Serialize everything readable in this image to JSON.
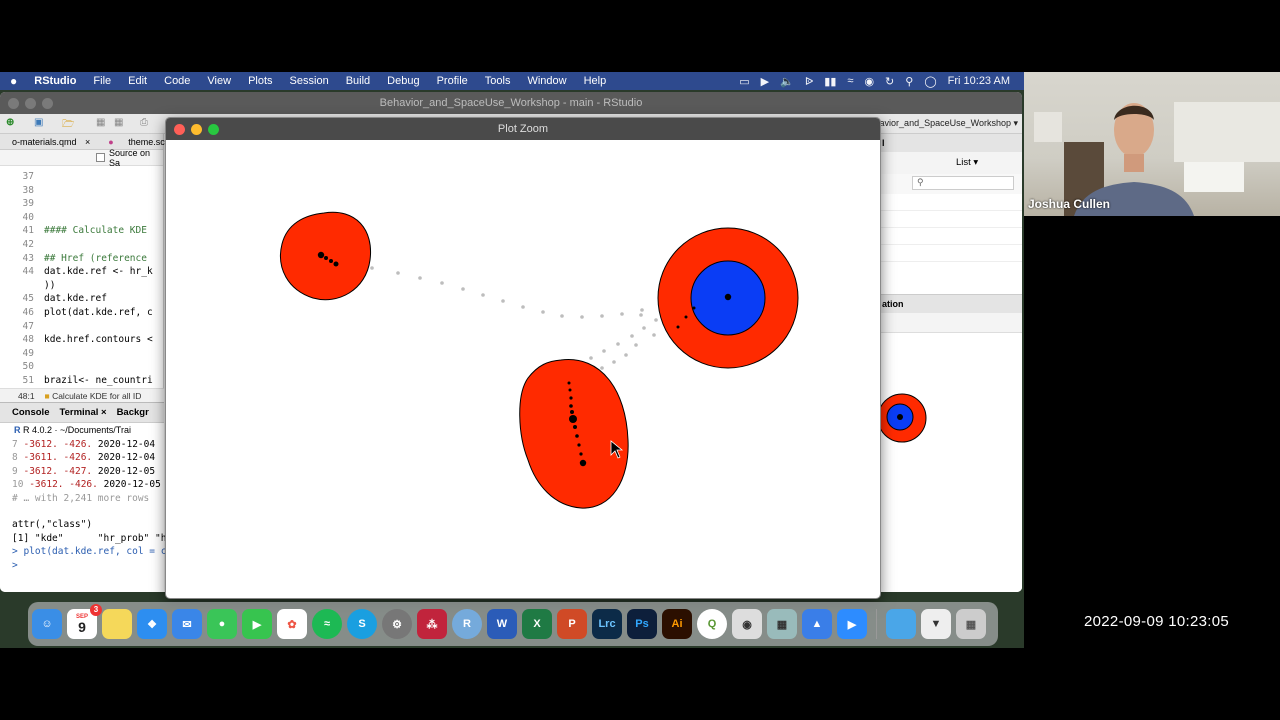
{
  "menubar": {
    "apple": "",
    "items": [
      "RStudio",
      "File",
      "Edit",
      "Code",
      "View",
      "Plots",
      "Session",
      "Build",
      "Debug",
      "Profile",
      "Tools",
      "Window",
      "Help"
    ],
    "clock": "Fri 10:23 AM"
  },
  "rstudio": {
    "window_title": "Behavior_and_SpaceUse_Workshop - main - RStudio",
    "project_label": "avior_and_SpaceUse_Workshop",
    "tabs": [
      "o-materials.qmd",
      "theme.scss"
    ],
    "source_on_save": "Source on Sa",
    "code_lines": [
      {
        "n": "37",
        "t": ""
      },
      {
        "n": "38",
        "t": ""
      },
      {
        "n": "39",
        "t": ""
      },
      {
        "n": "40",
        "t": ""
      },
      {
        "n": "41",
        "t": "#### Calculate KDE"
      },
      {
        "n": "42",
        "t": ""
      },
      {
        "n": "43",
        "t": "## Href (reference"
      },
      {
        "n": "44",
        "t": "dat.kde.ref <- hr_k"
      },
      {
        "n": "",
        "t": "))"
      },
      {
        "n": "45",
        "t": "dat.kde.ref"
      },
      {
        "n": "46",
        "t": "plot(dat.kde.ref, c"
      },
      {
        "n": "47",
        "t": ""
      },
      {
        "n": "48",
        "t": "kde.href.contours <"
      },
      {
        "n": "49",
        "t": ""
      },
      {
        "n": "50",
        "t": ""
      },
      {
        "n": "51",
        "t": "brazil<- ne_countri"
      }
    ],
    "status_pos": "48:1",
    "status_section": "Calculate KDE for all ID",
    "console_tabs": [
      "Console",
      "Terminal",
      "Backgr"
    ],
    "r_version": "R 4.0.2 · ~/Documents/Trai",
    "console_lines": [
      {
        "n": "7",
        "a": "-3612.",
        "b": "-426.",
        "c": "2020-12-04"
      },
      {
        "n": "8",
        "a": "-3611.",
        "b": "-426.",
        "c": "2020-12-04"
      },
      {
        "n": "9",
        "a": "-3612.",
        "b": "-427.",
        "c": "2020-12-05"
      },
      {
        "n": "10",
        "a": "-3612.",
        "b": "-426.",
        "c": "2020-12-05"
      }
    ],
    "console_more": "# … with 2,241 more rows",
    "console_attr": "attr(,\"class\")",
    "console_class": "[1] \"kde\"      \"hr_prob\" \"hr",
    "console_cmd": "> plot(dat.kde.ref, col = c",
    "console_prompt": ">",
    "right_pane_list": "List",
    "right_pane_label": "ation"
  },
  "plot_zoom": {
    "title": "Plot Zoom",
    "colors": {
      "outer": "#ff2a00",
      "inner": "#0a3df5",
      "points": "#000000",
      "track": "#bdbdbd"
    }
  },
  "dock": {
    "calendar_month": "SEP",
    "calendar_day": "9",
    "badge": "3",
    "icons": [
      "finder-icon",
      "calendar-icon",
      "notes-icon",
      "safari-icon",
      "mail-icon",
      "messages-icon",
      "facetime-icon",
      "photos-icon",
      "spotify-icon",
      "skype-icon",
      "system-preferences-icon",
      "mendeley-icon",
      "rstudio-icon",
      "word-icon",
      "excel-icon",
      "powerpoint-icon",
      "lightroom-icon",
      "photoshop-icon",
      "illustrator-icon",
      "qgis-icon",
      "screenshot-icon",
      "preview-icon",
      "keynote-icon",
      "zoom-icon",
      "folder-icon",
      "downloads-icon",
      "trash-icon"
    ],
    "labels": {
      "lightroom": "Lrc",
      "photoshop": "Ps",
      "illustrator": "Ai",
      "word": "W",
      "excel": "X",
      "powerpoint": "P"
    }
  },
  "webcam": {
    "name": "Joshua Cullen"
  },
  "timestamp": "2022-09-09  10:23:05"
}
